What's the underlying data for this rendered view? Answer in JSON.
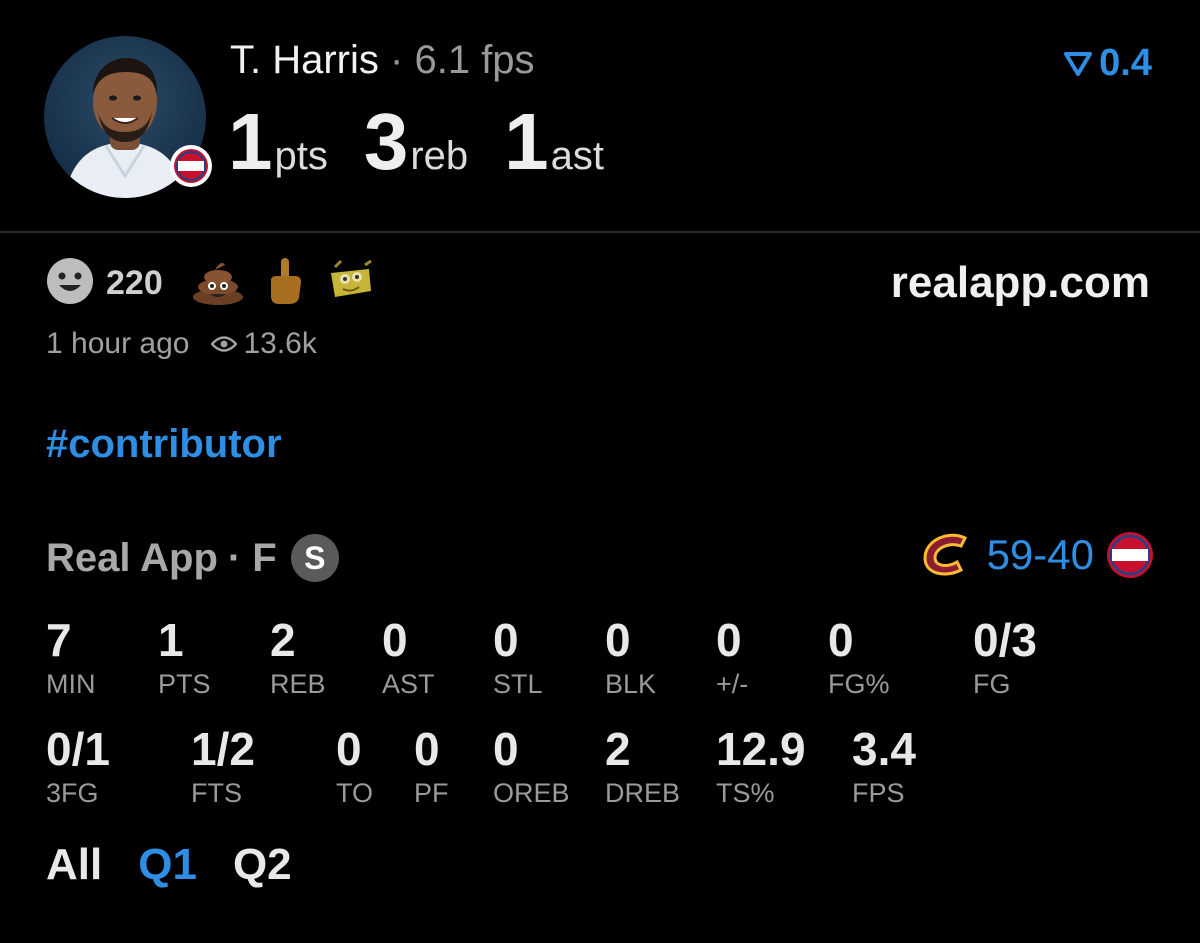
{
  "header": {
    "player_name": "T. Harris",
    "separator": "·",
    "fps": "6.1 fps",
    "pts": "1",
    "pts_unit": "pts",
    "reb": "3",
    "reb_unit": "reb",
    "ast": "1",
    "ast_unit": "ast",
    "vote_score": "0.4",
    "team_badge_text_1": "DETROIT",
    "team_badge_text_2": "PISTONS"
  },
  "reactions": {
    "count": "220",
    "items": [
      "smile-face",
      "poop",
      "middle-finger",
      "spongebob-meme"
    ]
  },
  "site": "realapp.com",
  "meta": {
    "time": "1 hour ago",
    "views": "13.6k"
  },
  "hashtag": "#contributor",
  "game": {
    "source": "Real App",
    "status": "· F",
    "s_badge": "S",
    "away_score": "59",
    "dash": "-",
    "home_score": "40"
  },
  "stats_row1": [
    {
      "value": "7",
      "label": "MIN"
    },
    {
      "value": "1",
      "label": "PTS"
    },
    {
      "value": "2",
      "label": "REB"
    },
    {
      "value": "0",
      "label": "AST"
    },
    {
      "value": "0",
      "label": "STL"
    },
    {
      "value": "0",
      "label": "BLK"
    },
    {
      "value": "0",
      "label": "+/-"
    },
    {
      "value": "0",
      "label": "FG%"
    },
    {
      "value": "0/3",
      "label": "FG"
    }
  ],
  "stats_row2": [
    {
      "value": "0/1",
      "label": "3FG"
    },
    {
      "value": "1/2",
      "label": "FTS"
    },
    {
      "value": "0",
      "label": "TO"
    },
    {
      "value": "0",
      "label": "PF"
    },
    {
      "value": "0",
      "label": "OREB"
    },
    {
      "value": "2",
      "label": "DREB"
    },
    {
      "value": "12.9",
      "label": "TS%"
    },
    {
      "value": "3.4",
      "label": "FPS"
    }
  ],
  "tabs": [
    "All",
    "Q1",
    "Q2"
  ],
  "active_tab": "Q1",
  "colors": {
    "accent": "#2d8ee4",
    "background": "#000000",
    "muted": "#9a9a9a"
  }
}
